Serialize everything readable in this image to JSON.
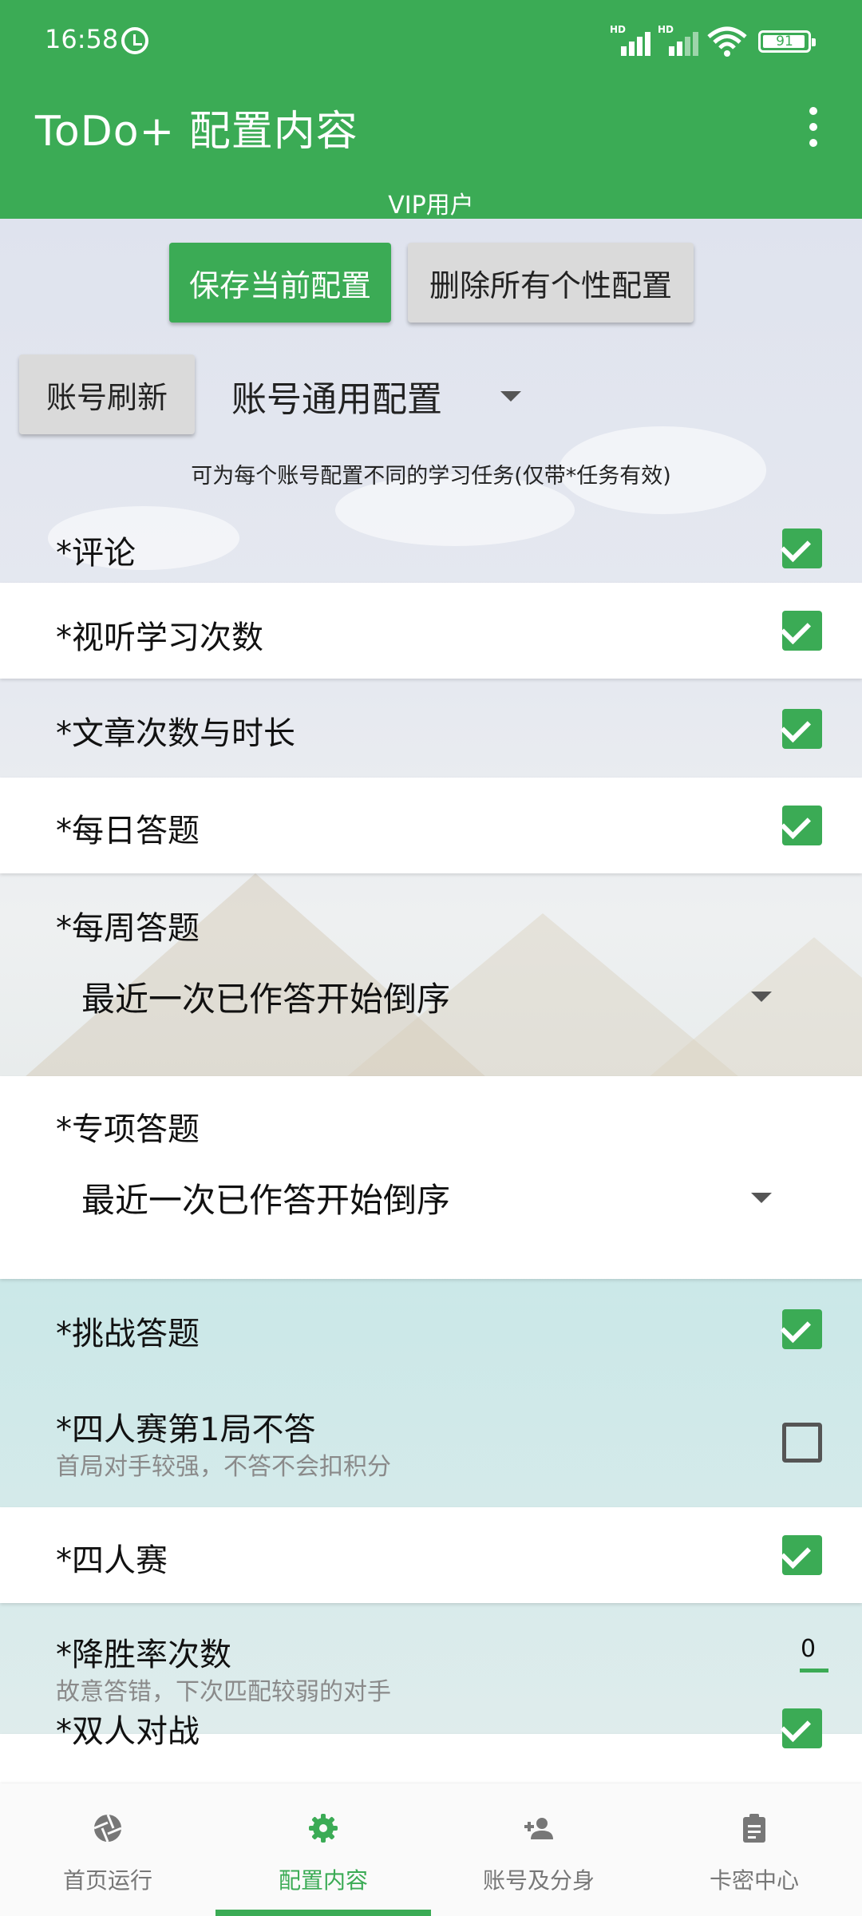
{
  "status_bar": {
    "time": "16:58",
    "signal1_label": "HD",
    "signal2_label": "HD",
    "battery": "91"
  },
  "app_bar": {
    "title": "ToDo+ 配置内容",
    "subtitle": "VIP用户",
    "menu_icon": "more-vert-icon"
  },
  "actions": {
    "save_label": "保存当前配置",
    "delete_label": "删除所有个性配置",
    "refresh_label": "账号刷新",
    "account_select": "账号通用配置",
    "hint": "可为每个账号配置不同的学习任务(仅带*任务有效)"
  },
  "settings": [
    {
      "label": "*评论",
      "checked": true
    },
    {
      "label": "*视听学习次数",
      "checked": true
    },
    {
      "label": "*文章次数与时长",
      "checked": true
    },
    {
      "label": "*每日答题",
      "checked": true
    },
    {
      "label": "*每周答题",
      "select": "最近一次已作答开始倒序"
    },
    {
      "label": "*专项答题",
      "select": "最近一次已作答开始倒序"
    },
    {
      "label": "*挑战答题",
      "checked": true
    },
    {
      "label": "*四人赛第1局不答",
      "sublabel": "首局对手较强，不答不会扣积分",
      "checked": false
    },
    {
      "label": "*四人赛",
      "checked": true
    },
    {
      "label": "*降胜率次数",
      "sublabel": "故意答错，下次匹配较弱的对手",
      "value": "0"
    },
    {
      "label": "*双人对战",
      "checked": true
    }
  ],
  "bottom_nav": [
    {
      "label": "首页运行",
      "icon": "aperture-icon",
      "active": false
    },
    {
      "label": "配置内容",
      "icon": "gear-icon",
      "active": true
    },
    {
      "label": "账号及分身",
      "icon": "add-person-icon",
      "active": false
    },
    {
      "label": "卡密中心",
      "icon": "clipboard-icon",
      "active": false
    }
  ],
  "colors": {
    "primary": "#3bab55",
    "text": "#111111",
    "subtext": "#8a8a8a"
  }
}
